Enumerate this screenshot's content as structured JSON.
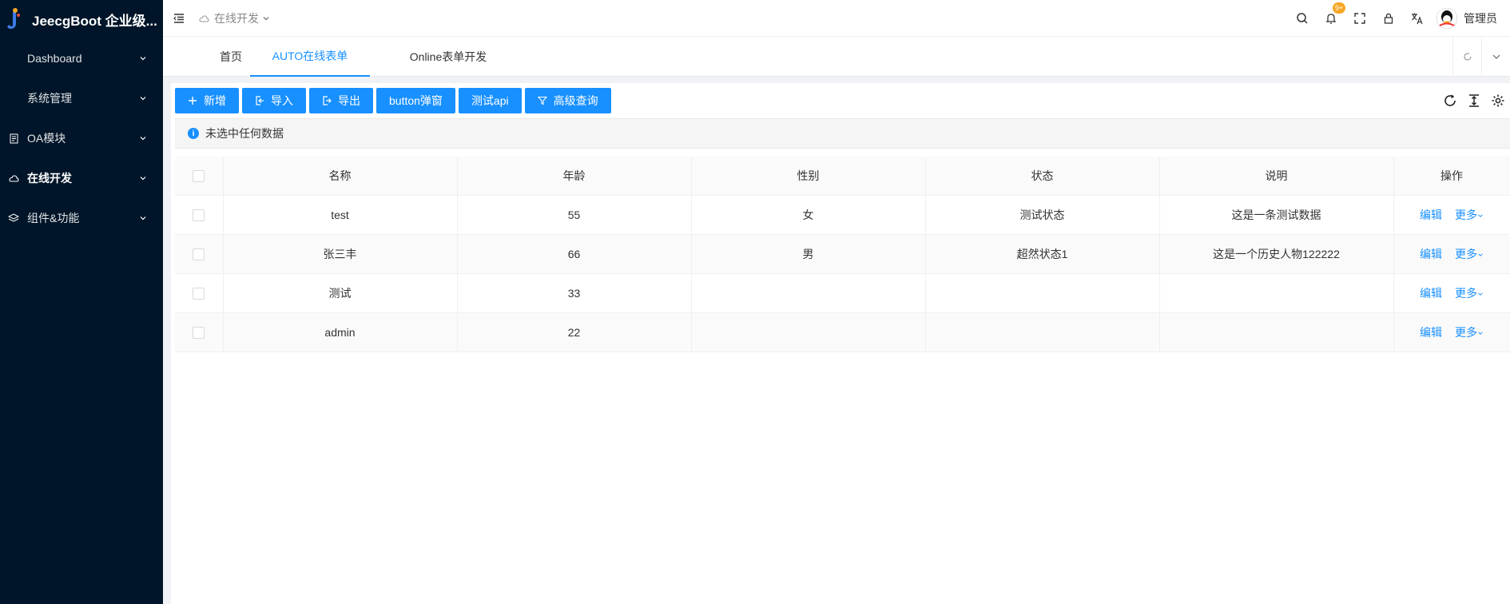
{
  "app": {
    "title": "JeecgBoot 企业级..."
  },
  "sidebar": {
    "items": [
      {
        "label": "Dashboard",
        "icon": "dashboard-icon"
      },
      {
        "label": "系统管理",
        "icon": "settings-icon"
      },
      {
        "label": "OA模块",
        "icon": "document-icon"
      },
      {
        "label": "在线开发",
        "icon": "cloud-icon"
      },
      {
        "label": "组件&功能",
        "icon": "layers-icon"
      }
    ]
  },
  "header": {
    "breadcrumb": "在线开发",
    "notification_badge": "9+",
    "user_name": "管理员"
  },
  "tabs": [
    {
      "label": "首页"
    },
    {
      "label": "AUTO在线表单"
    },
    {
      "label": "Online表单开发"
    }
  ],
  "toolbar": {
    "add": "新增",
    "import": "导入",
    "export": "导出",
    "popup": "button弹窗",
    "test_api": "测试api",
    "advanced_query": "高级查询"
  },
  "alert": {
    "text": "未选中任何数据"
  },
  "table": {
    "columns": [
      "名称",
      "年龄",
      "性别",
      "状态",
      "说明",
      "操作"
    ],
    "rows": [
      {
        "name": "test",
        "age": "55",
        "gender": "女",
        "status": "测试状态",
        "desc": "这是一条测试数据"
      },
      {
        "name": "张三丰",
        "age": "66",
        "gender": "男",
        "status": "超然状态1",
        "desc": "这是一个历史人物122222"
      },
      {
        "name": "测试",
        "age": "33",
        "gender": "",
        "status": "",
        "desc": ""
      },
      {
        "name": "admin",
        "age": "22",
        "gender": "",
        "status": "",
        "desc": ""
      }
    ],
    "edit_label": "编辑",
    "more_label": "更多"
  },
  "colors": {
    "sidebar_bg": "#001529",
    "primary": "#1890ff",
    "badge": "#f5a623"
  }
}
